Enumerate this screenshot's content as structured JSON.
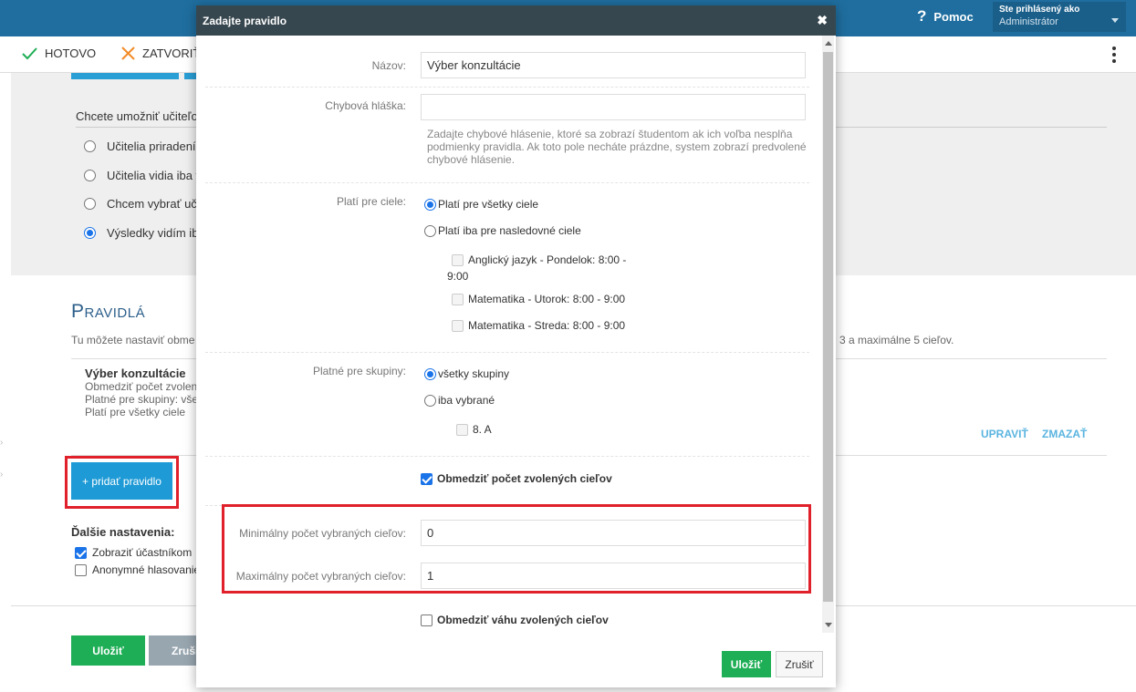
{
  "topbar": {
    "help_label": "Pomoc",
    "user_line1": "Ste prihlásený ako",
    "user_line2": "Administrátor"
  },
  "toolbar": {
    "done_label": "HOTOVO",
    "close_label": "ZATVORIŤ"
  },
  "background": {
    "question": "Chcete umožniť učiteľo",
    "options": [
      "Učitelia priradení k",
      "Učitelia vidia iba v",
      "Chcem vybrať uči",
      "Výsledky vidím iba"
    ],
    "selected_option_index": 3,
    "rules_title": "Pravidlá",
    "rules_desc": "Tu môžete nastaviť obme",
    "rules_desc_tail": "3 a maximálne 5 cieľov.",
    "rule": {
      "name": "Výber konzultácie",
      "line1": "Obmedziť počet zvolen",
      "line2": "Platné pre skupiny: vše",
      "line3": "Platí pre všetky ciele",
      "edit": "UPRAVIŤ",
      "delete": "ZMAZAŤ"
    },
    "add_rule_label": "+ pridať pravidlo",
    "more_title": "Ďalšie nastavenia:",
    "more_show": "Zobraziť účastníkom",
    "more_anon": "Anonymné hlasovanie",
    "save_label": "Uložiť",
    "cancel_label": "Zruši"
  },
  "modal": {
    "title": "Zadajte pravidlo",
    "close_glyph": "✖",
    "name_label": "Názov:",
    "name_value": "Výber konzultácie",
    "error_label": "Chybová hláška:",
    "error_value": "",
    "error_help": "Zadajte chybové hlásenie, ktoré sa zobrazí študentom ak ich voľba nesplňa podmienky pravidla. Ak toto pole necháte prázdne, system zobrazí predvolené chybové hlásenie.",
    "targets_label": "Platí pre ciele:",
    "targets_all": "Platí pre všetky ciele",
    "targets_some": "Platí iba pre nasledovné ciele",
    "target_item1_a": "Anglický jazyk - Pondelok: 8:00 -",
    "target_item1_b": "9:00",
    "target_item2": "Matematika - Utorok: 8:00 - 9:00",
    "target_item3": "Matematika - Streda: 8:00 - 9:00",
    "groups_label": "Platné pre skupiny:",
    "groups_all": "všetky skupiny",
    "groups_some": "iba vybrané",
    "group_item1": "8. A",
    "limit_count_label": "Obmedziť počet zvolených cieľov",
    "min_label": "Minimálny počet vybraných cieľov:",
    "min_value": "0",
    "max_label": "Maximálny počet vybraných cieľov:",
    "max_value": "1",
    "limit_weight_label": "Obmedziť váhu zvolených cieľov",
    "save_label": "Uložiť",
    "cancel_label": "Zrušiť"
  },
  "colors": {
    "topbar": "#1f6e9f",
    "modal_header": "#37474f",
    "save_green": "#1eae55",
    "add_blue": "#1e9ad6",
    "highlight_red": "#e0202a",
    "link_blue": "#5ab4e0"
  }
}
